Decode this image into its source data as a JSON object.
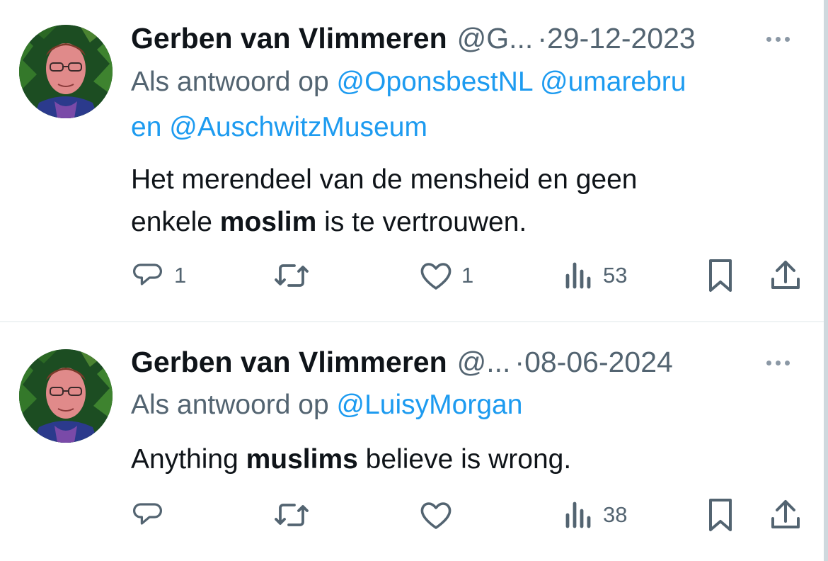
{
  "tweets": [
    {
      "author_name": "Gerben van Vlimmeren",
      "handle": "@G...",
      "separator": "·",
      "date": "29-12-2023",
      "reply_prefix": "Als antwoord op",
      "reply_mentions": [
        "@OponsbestNL",
        "@umarebru"
      ],
      "reply_joiner": "en",
      "reply_last_mention": "@AuschwitzMuseum",
      "text_line1": "Het merendeel van de mensheid en geen",
      "text_line2_before": "enkele ",
      "text_bold": "moslim",
      "text_line2_after": " is te vertrouwen.",
      "reply_count": "1",
      "retweet_count": "",
      "like_count": "1",
      "view_count": "53"
    },
    {
      "author_name": "Gerben van Vlimmeren",
      "handle": "@...",
      "separator": "·",
      "date": "08-06-2024",
      "reply_prefix": "Als antwoord op",
      "reply_mention": "@LuisyMorgan",
      "text_before": "Anything ",
      "text_bold": "muslims",
      "text_after": " believe is wrong.",
      "reply_count": "",
      "retweet_count": "",
      "like_count": "",
      "view_count": "38"
    }
  ],
  "icons": {
    "reply": "reply-icon",
    "retweet": "retweet-icon",
    "like": "heart-icon",
    "views": "views-icon",
    "bookmark": "bookmark-icon",
    "share": "share-icon",
    "more": "more-icon"
  },
  "colors": {
    "text": "#0f1419",
    "secondary": "#536471",
    "link": "#1d9bf0"
  }
}
